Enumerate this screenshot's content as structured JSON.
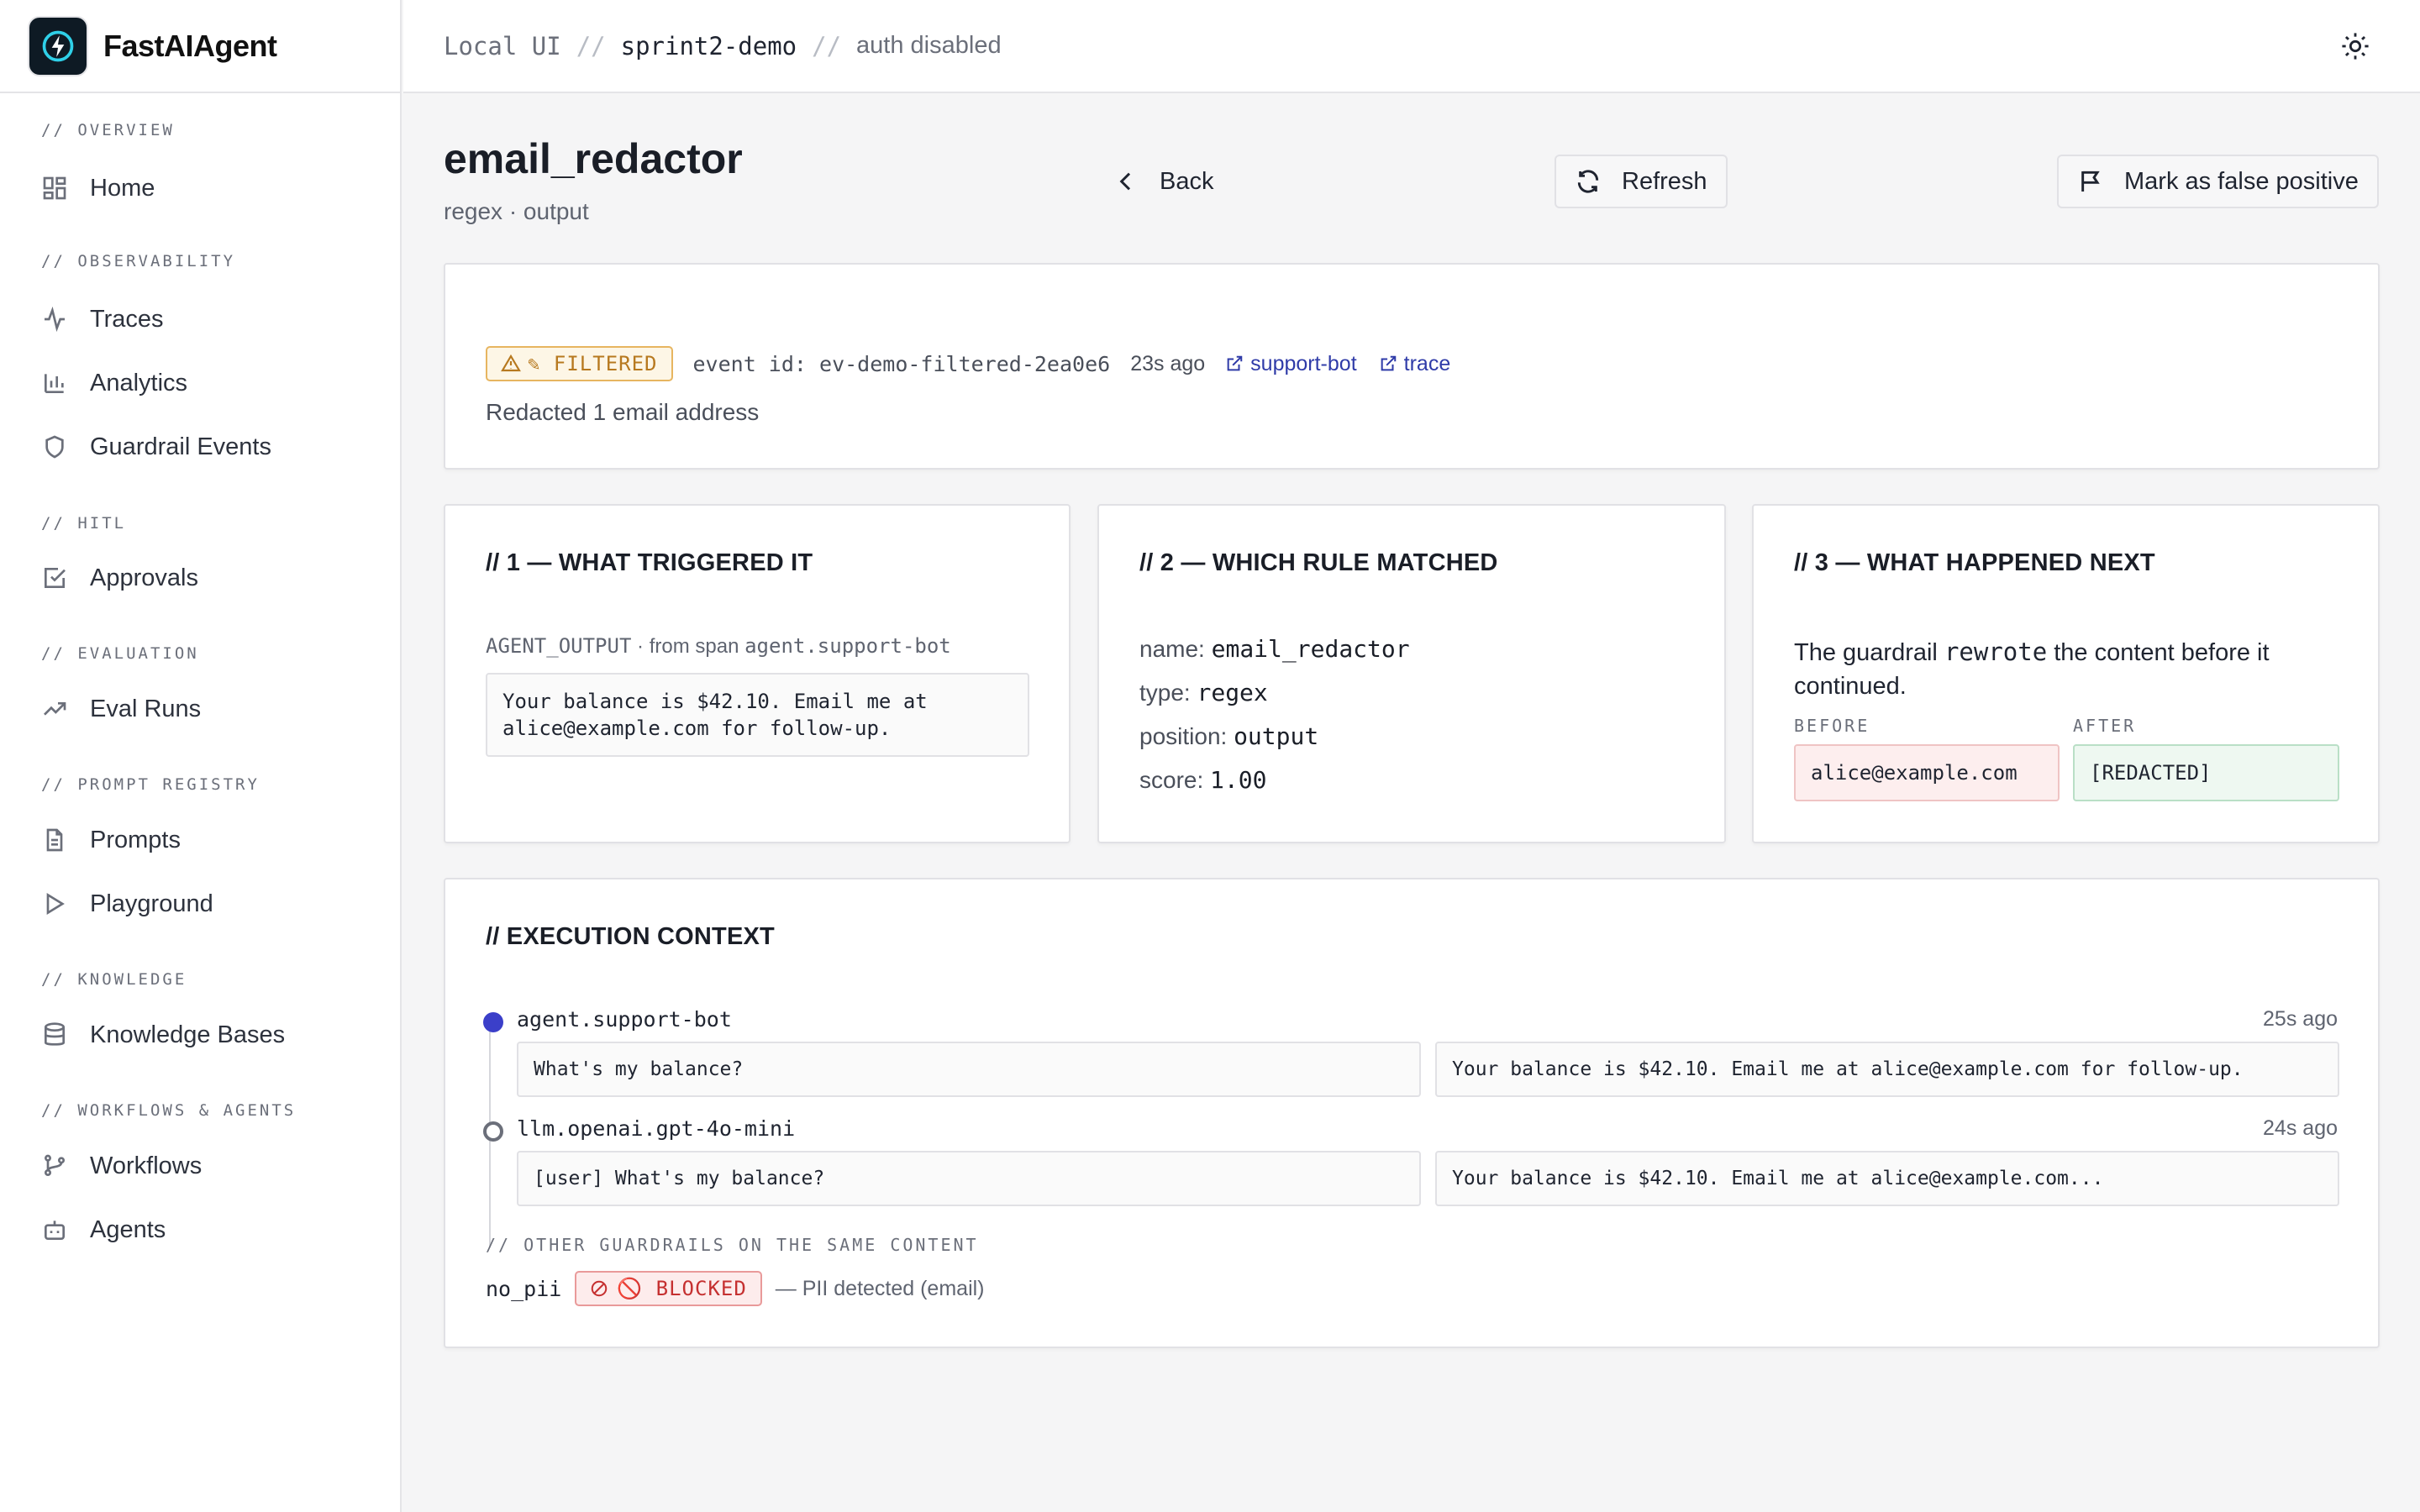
{
  "brand": {
    "name": "FastAIAgent"
  },
  "sidebar": {
    "sections": [
      {
        "label": "// OVERVIEW",
        "items": [
          {
            "label": "Home",
            "icon": "grid-icon"
          }
        ]
      },
      {
        "label": "// OBSERVABILITY",
        "items": [
          {
            "label": "Traces",
            "icon": "activity-icon"
          },
          {
            "label": "Analytics",
            "icon": "bar-chart-icon"
          },
          {
            "label": "Guardrail Events",
            "icon": "shield-icon"
          }
        ]
      },
      {
        "label": "// HITL",
        "items": [
          {
            "label": "Approvals",
            "icon": "check-square-icon"
          }
        ]
      },
      {
        "label": "// EVALUATION",
        "items": [
          {
            "label": "Eval Runs",
            "icon": "trending-up-icon"
          }
        ]
      },
      {
        "label": "// PROMPT REGISTRY",
        "items": [
          {
            "label": "Prompts",
            "icon": "file-text-icon"
          },
          {
            "label": "Playground",
            "icon": "play-icon"
          }
        ]
      },
      {
        "label": "// KNOWLEDGE",
        "items": [
          {
            "label": "Knowledge Bases",
            "icon": "database-icon"
          }
        ]
      },
      {
        "label": "// WORKFLOWS & AGENTS",
        "items": [
          {
            "label": "Workflows",
            "icon": "git-branch-icon"
          },
          {
            "label": "Agents",
            "icon": "bot-icon"
          }
        ]
      }
    ]
  },
  "topbar": {
    "crumb1": "Local UI",
    "sep": "//",
    "crumb2": "sprint2-demo",
    "crumb3": "auth disabled"
  },
  "page": {
    "title": "email_redactor",
    "subtitle": "regex · output",
    "back_label": "Back",
    "refresh_label": "Refresh",
    "false_positive_label": "Mark as false positive"
  },
  "event": {
    "status": "✎ FILTERED",
    "event_id": "event id: ev-demo-filtered-2ea0e6",
    "age": "23s ago",
    "link_agent": "support-bot",
    "link_trace": "trace",
    "summary": "Redacted 1 email address"
  },
  "triggered": {
    "title": "// 1 — WHAT TRIGGERED IT",
    "source_kind": "AGENT_OUTPUT",
    "source_from": " · from span ",
    "source_span": "agent.support-bot",
    "content_line1": "Your balance is $42.10. Email me at",
    "content_line2": "alice@example.com for follow-up."
  },
  "rule": {
    "title": "// 2 — WHICH RULE MATCHED",
    "name_label": "name: ",
    "name_value": "email_redactor",
    "type_label": "type: ",
    "type_value": "regex",
    "position_label": "position: ",
    "position_value": "output",
    "score_label": "score: ",
    "score_value": "1.00"
  },
  "next": {
    "title": "// 3 — WHAT HAPPENED NEXT",
    "text_pre": "The guardrail ",
    "text_code": "rewrote",
    "text_post": " the content before it",
    "text_line2": "continued.",
    "before_label": "BEFORE",
    "before_value": "alice@example.com",
    "after_label": "AFTER",
    "after_value": "[REDACTED]"
  },
  "context": {
    "title": "// EXECUTION CONTEXT",
    "spans": [
      {
        "name": "agent.support-bot",
        "age": "25s ago",
        "input": "What's my balance?",
        "output": "Your balance is $42.10. Email me at alice@example.com for follow-up."
      },
      {
        "name": "llm.openai.gpt-4o-mini",
        "age": "24s ago",
        "input": "[user] What's my balance?",
        "output": "Your balance is $42.10. Email me at alice@example.com..."
      }
    ],
    "other_label": "// OTHER GUARDRAILS ON THE SAME CONTENT",
    "other_name": "no_pii",
    "other_status": "🚫 BLOCKED",
    "other_reason": "— PII detected (email)"
  },
  "colors": {
    "accent": "#3b3fc9",
    "filtered": "#b7791f",
    "blocked": "#c53030",
    "before_bg": "#fdeeee",
    "after_bg": "#eef8f1"
  }
}
